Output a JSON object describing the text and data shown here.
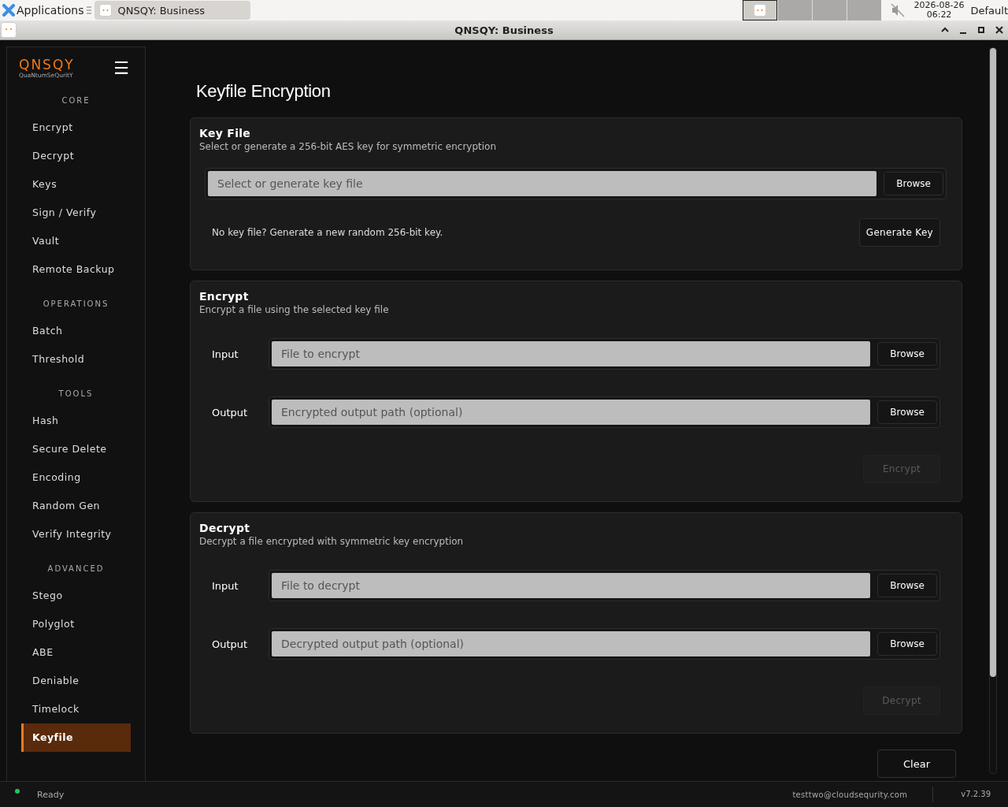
{
  "taskbar": {
    "apps_label": "Applications",
    "task": {
      "title": "QNSQY: Business",
      "selected": true
    },
    "workspaces": [
      {
        "selected": true,
        "has_window": true
      },
      {
        "selected": false,
        "has_window": false
      },
      {
        "selected": false,
        "has_window": false
      },
      {
        "selected": false,
        "has_window": false
      }
    ],
    "muted": true,
    "date": "2026-08-26",
    "time": "06:22",
    "layout": "Default"
  },
  "window": {
    "title": "QNSQY: Business"
  },
  "sidebar": {
    "logo": "QNSQY",
    "tagline": "QuaNtumSeQuritY",
    "menu_icon": "☰",
    "sections": [
      {
        "title": "CORE",
        "items": [
          {
            "label": "Encrypt",
            "selected": false
          },
          {
            "label": "Decrypt",
            "selected": false
          },
          {
            "label": "Keys",
            "selected": false
          },
          {
            "label": "Sign / Verify",
            "selected": false
          },
          {
            "label": "Vault",
            "selected": false
          },
          {
            "label": "Remote Backup",
            "selected": false
          }
        ]
      },
      {
        "title": "OPERATIONS",
        "items": [
          {
            "label": "Batch",
            "selected": false
          },
          {
            "label": "Threshold",
            "selected": false
          }
        ]
      },
      {
        "title": "TOOLS",
        "items": [
          {
            "label": "Hash",
            "selected": false
          },
          {
            "label": "Secure Delete",
            "selected": false
          },
          {
            "label": "Encoding",
            "selected": false
          },
          {
            "label": "Random Gen",
            "selected": false
          },
          {
            "label": "Verify Integrity",
            "selected": false
          }
        ]
      },
      {
        "title": "ADVANCED",
        "items": [
          {
            "label": "Stego",
            "selected": false
          },
          {
            "label": "Polyglot",
            "selected": false
          },
          {
            "label": "ABE",
            "selected": false
          },
          {
            "label": "Deniable",
            "selected": false
          },
          {
            "label": "Timelock",
            "selected": false
          },
          {
            "label": "Keyfile",
            "selected": true
          }
        ]
      }
    ]
  },
  "page_title": "Keyfile Encryption",
  "cards": [
    {
      "kind": "keyfile",
      "title": "Key File",
      "subtitle": "Select or generate a 256-bit AES key for symmetric encryption",
      "field": {
        "placeholder": "Select or generate key file",
        "button": "Browse"
      },
      "hint": "No key file? Generate a new random 256-bit key.",
      "action": {
        "label": "Generate Key",
        "disabled": false
      }
    },
    {
      "kind": "operation",
      "title": "Encrypt",
      "subtitle": "Encrypt a file using the selected key file",
      "rows": [
        {
          "label": "Input",
          "placeholder": "File to encrypt",
          "button": "Browse"
        },
        {
          "label": "Output",
          "placeholder": "Encrypted output path (optional)",
          "button": "Browse"
        }
      ],
      "action": {
        "label": "Encrypt",
        "disabled": true
      }
    },
    {
      "kind": "operation",
      "title": "Decrypt",
      "subtitle": "Decrypt a file encrypted with symmetric key encryption",
      "rows": [
        {
          "label": "Input",
          "placeholder": "File to decrypt",
          "button": "Browse"
        },
        {
          "label": "Output",
          "placeholder": "Decrypted output path (optional)",
          "button": "Browse"
        }
      ],
      "action": {
        "label": "Decrypt",
        "disabled": true
      }
    }
  ],
  "clear_button": "Clear",
  "status_bar": {
    "status": "Ready",
    "user": "testtwo@cloudsequrity.com",
    "version": "v7.2.39"
  }
}
